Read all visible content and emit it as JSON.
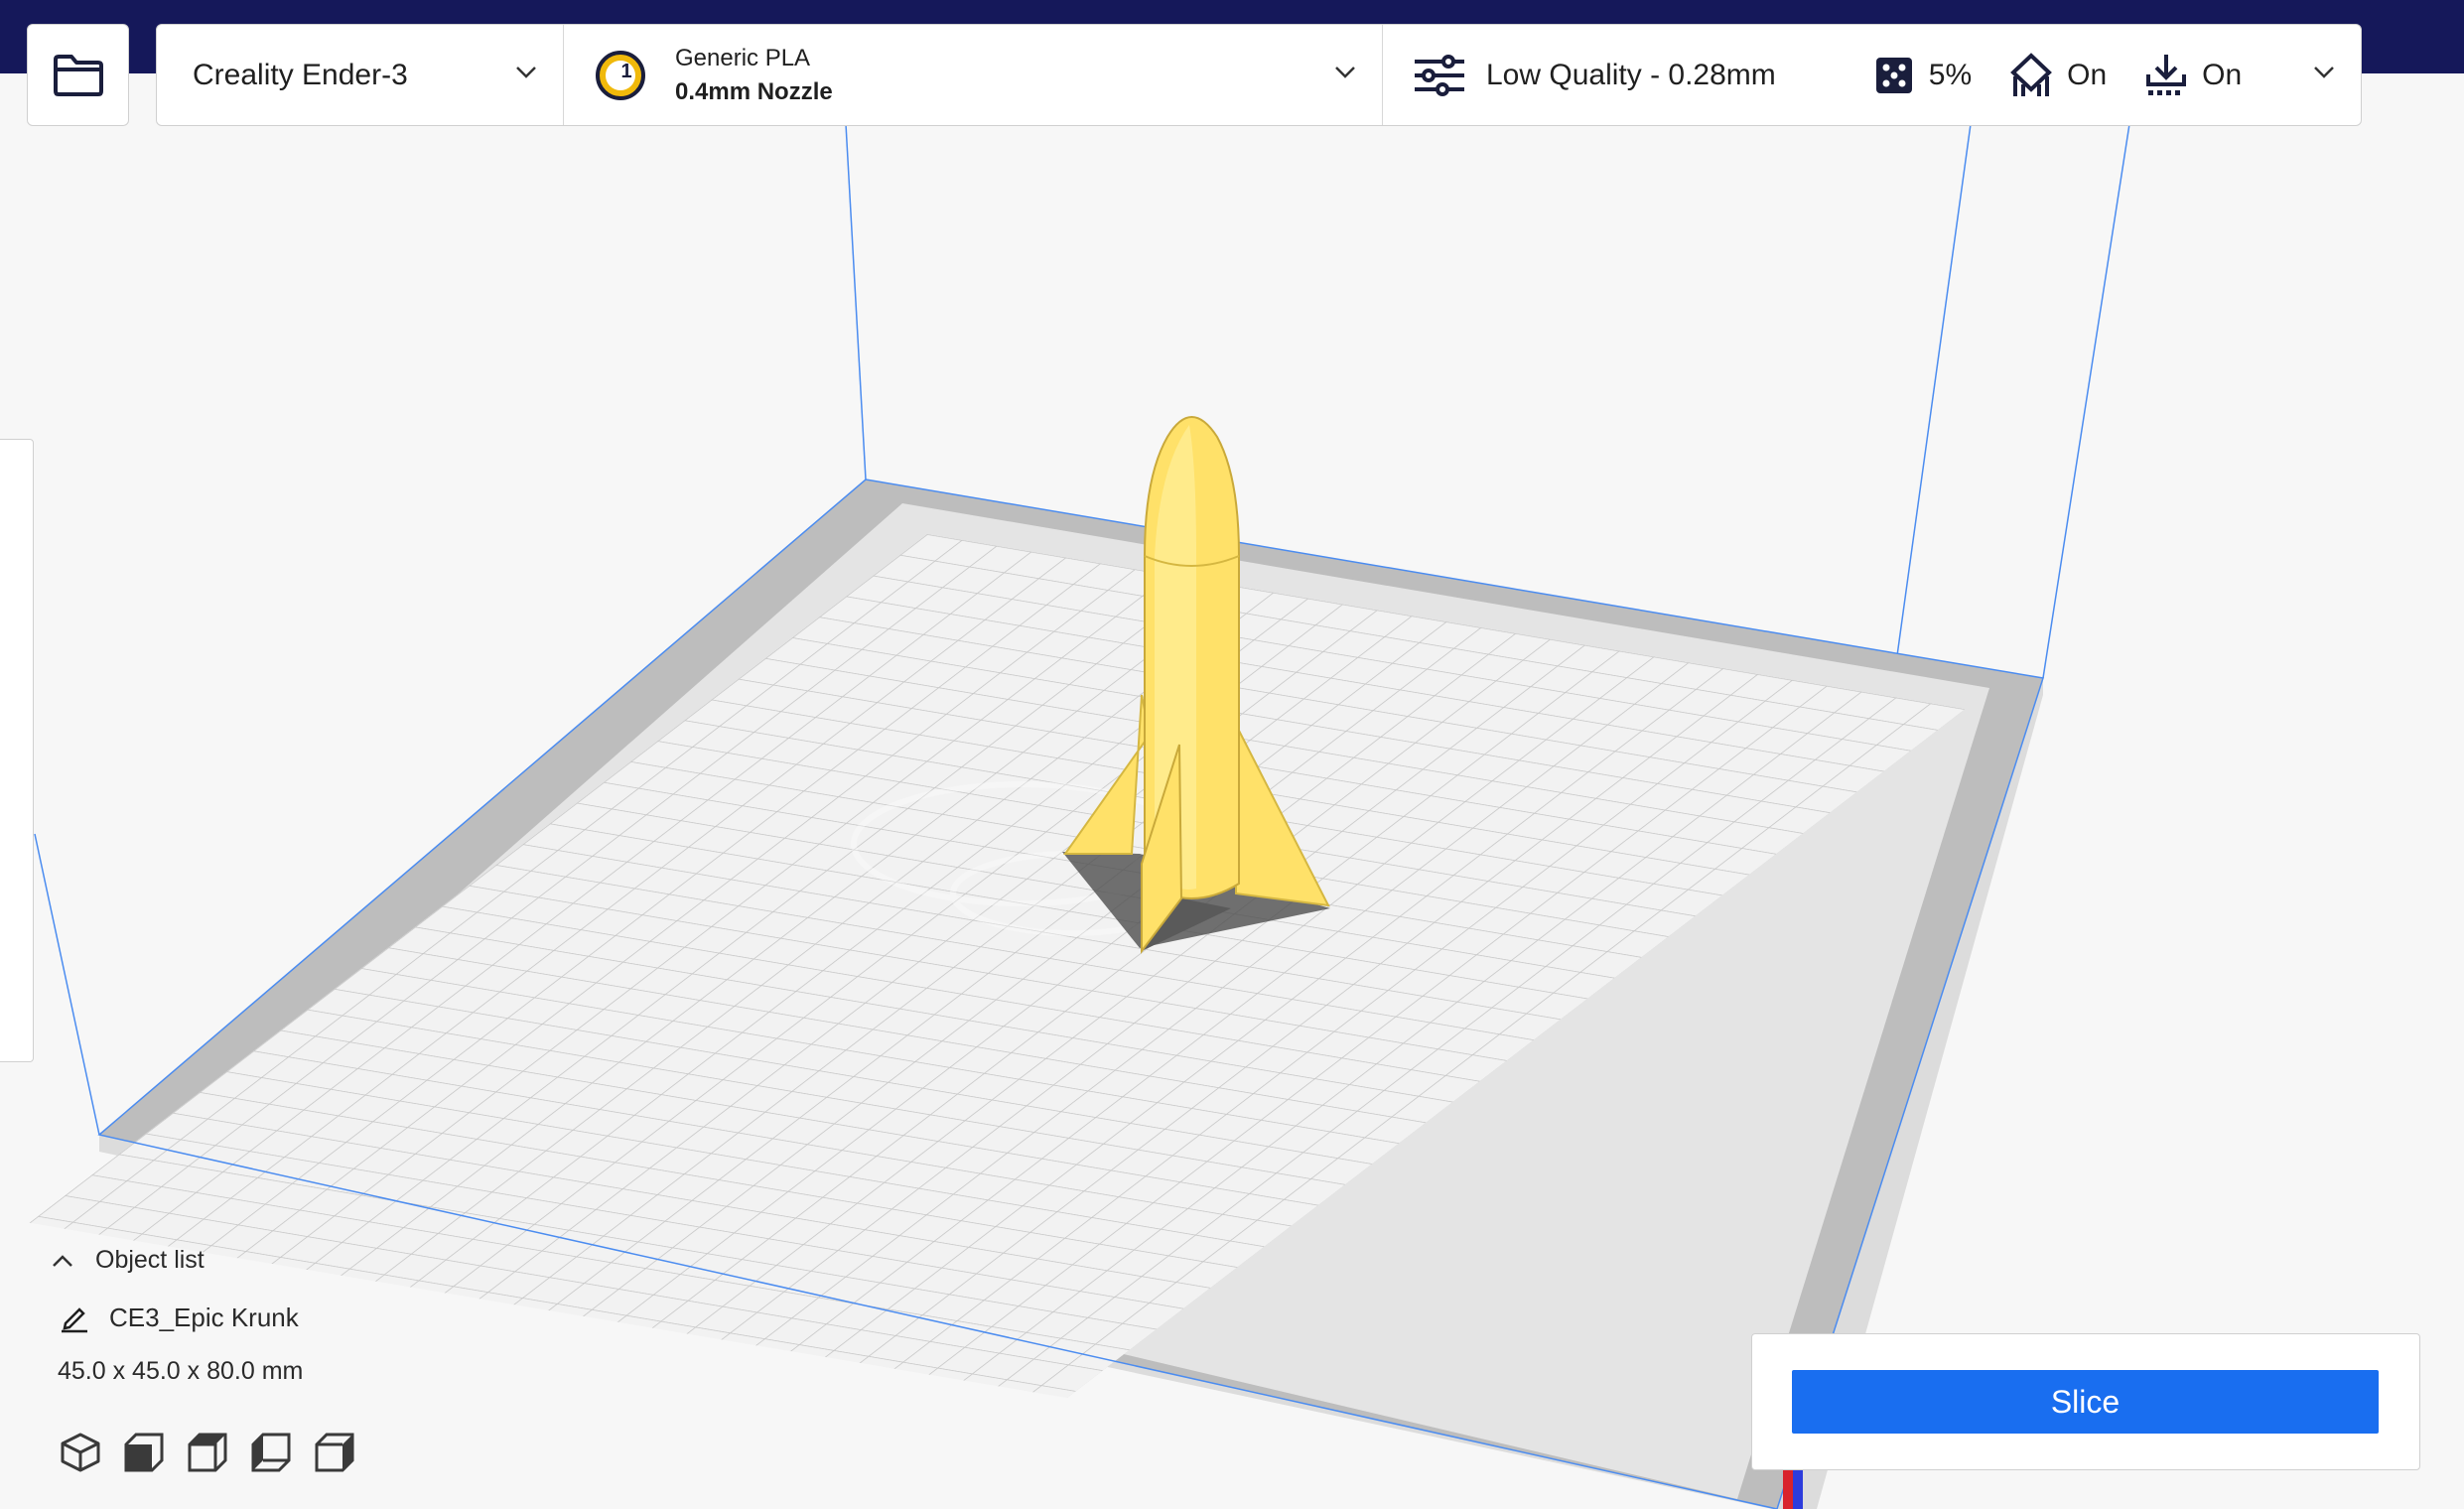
{
  "header": {
    "printer": {
      "name": "Creality Ender-3"
    },
    "material": {
      "extruder_number": "1",
      "material": "Generic PLA",
      "nozzle": "0.4mm Nozzle"
    },
    "print_settings": {
      "profile": "Low Quality - 0.28mm",
      "infill": "5%",
      "support": "On",
      "adhesion": "On"
    }
  },
  "object_panel": {
    "title": "Object list",
    "object_name": "CE3_Epic Krunk",
    "dimensions": "45.0 x 45.0 x 80.0 mm"
  },
  "view_buttons": [
    "3d-view",
    "front-view",
    "top-view",
    "left-view",
    "right-view"
  ],
  "action": {
    "slice_label": "Slice"
  },
  "colors": {
    "top_band": "#15185a",
    "accent": "#196ef0",
    "model": "#ffe169",
    "build_plate": "#f2f2f2",
    "disallowed_border": "#b4b4b4",
    "volume_edges": "#4b8cf0"
  }
}
